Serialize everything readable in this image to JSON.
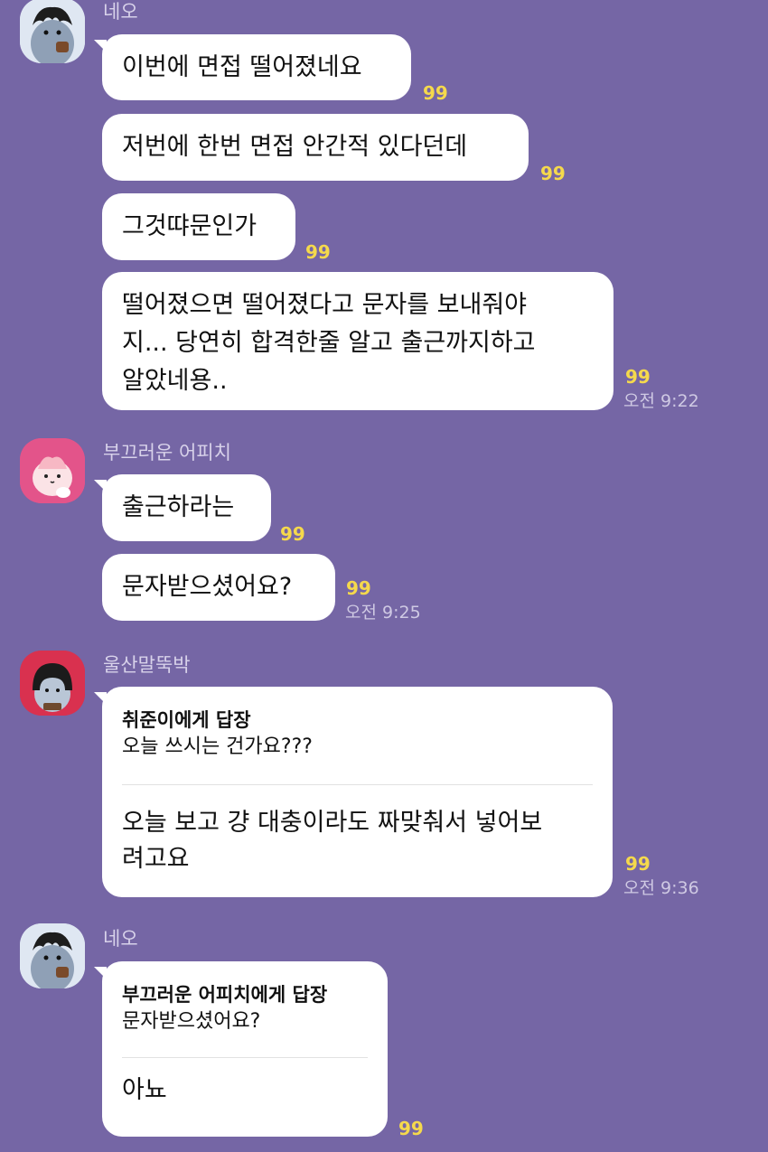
{
  "messages": {
    "m1": {
      "sender": "네오",
      "text": "이번에 면접 떨어졌네요",
      "count": "99"
    },
    "m2": {
      "text": "저번에 한번 면접 안간적 있다던데",
      "count": "99"
    },
    "m3": {
      "text": "그것땨문인가",
      "count": "99"
    },
    "m4": {
      "lines": [
        "떨어졌으면 떨어졌다고 문자를 보내줘야",
        "지... 당연히 합격한줄 알고 출근까지하고",
        "알았네용.."
      ],
      "count": "99",
      "time": "오전 9:22"
    },
    "m5": {
      "sender": "부끄러운 어피치",
      "text": "출근하라는",
      "count": "99"
    },
    "m6": {
      "text": "문자받으셨어요?",
      "count": "99",
      "time": "오전 9:25"
    },
    "m7": {
      "sender": "울산말뚝박",
      "reply_to": "취준이에게 답장",
      "quote": "오늘 쓰시는 건가요???",
      "lines": [
        "오늘 보고 걍 대충이라도 짜맞춰서 넣어보",
        "려고요"
      ],
      "count": "99",
      "time": "오전 9:36"
    },
    "m8": {
      "sender": "네오",
      "reply_to": "부끄러운 어피치에게 답장",
      "quote": "문자받으셨어요?",
      "text": "아뇨",
      "count": "99"
    }
  },
  "colors": {
    "background": "#7566a5",
    "bubble": "#ffffff",
    "unread_count": "#f5d94c"
  },
  "avatars": {
    "neo": "neo-character-icon",
    "apeach": "apeach-character-icon",
    "ulsan": "character-with-bob-hair-icon"
  }
}
